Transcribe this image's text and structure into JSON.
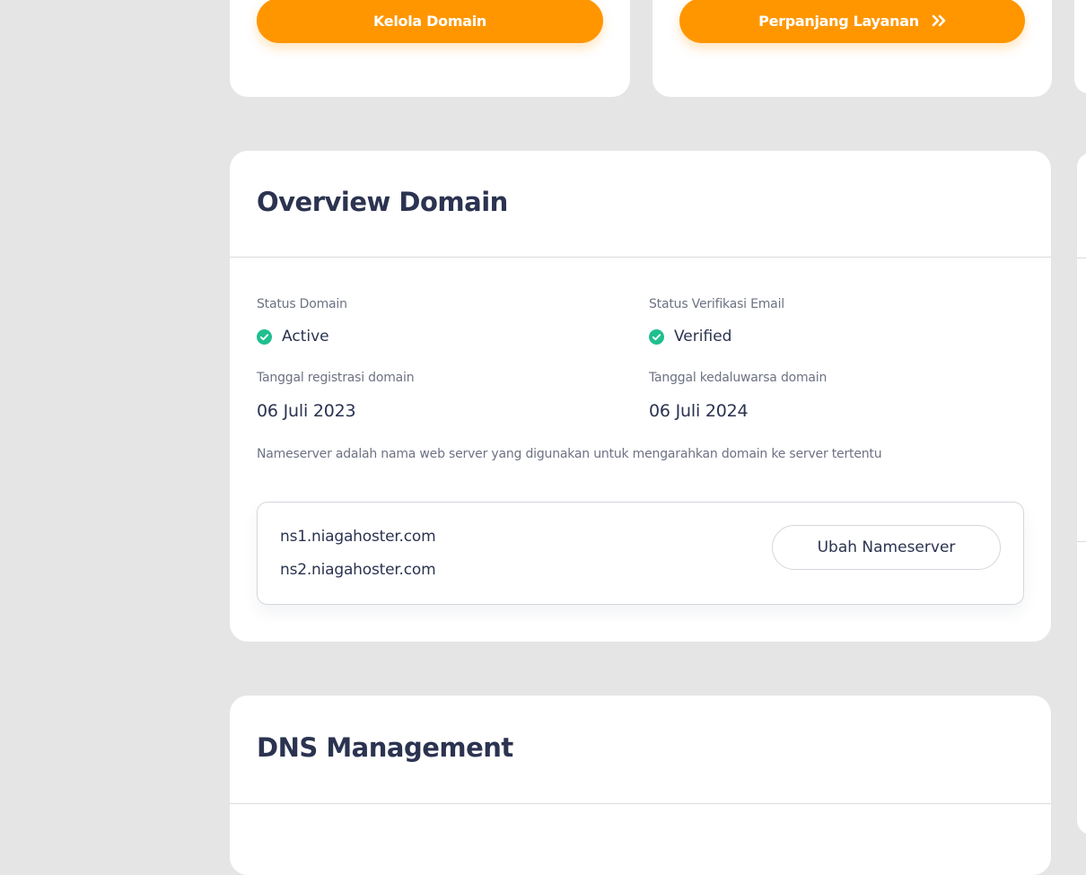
{
  "top_actions": {
    "kelola_label": "Kelola Domain",
    "perpanjang_label": "Perpanjang Layanan"
  },
  "overview": {
    "title": "Overview Domain",
    "status_domain_label": "Status Domain",
    "status_domain_value": "Active",
    "status_email_label": "Status Verifikasi Email",
    "status_email_value": "Verified",
    "reg_date_label": "Tanggal registrasi domain",
    "reg_date_value": "06 Juli 2023",
    "exp_date_label": "Tanggal kedaluwarsa domain",
    "exp_date_value": "06 Juli 2024",
    "nameserver_desc": "Nameserver adalah nama web server yang digunakan untuk mengarahkan domain ke server tertentu",
    "nameservers": [
      "ns1.niagahoster.com",
      "ns2.niagahoster.com"
    ],
    "change_ns_label": "Ubah Nameserver"
  },
  "dns": {
    "title": "DNS Management"
  },
  "colors": {
    "accent": "#ff9600",
    "success": "#1fbf8f",
    "background": "#e5e5e5",
    "text": "#2b3350",
    "muted": "#6d7283"
  },
  "icons": {
    "status_ok": "check-circle-icon",
    "renew": "double-chevron-right-icon"
  }
}
